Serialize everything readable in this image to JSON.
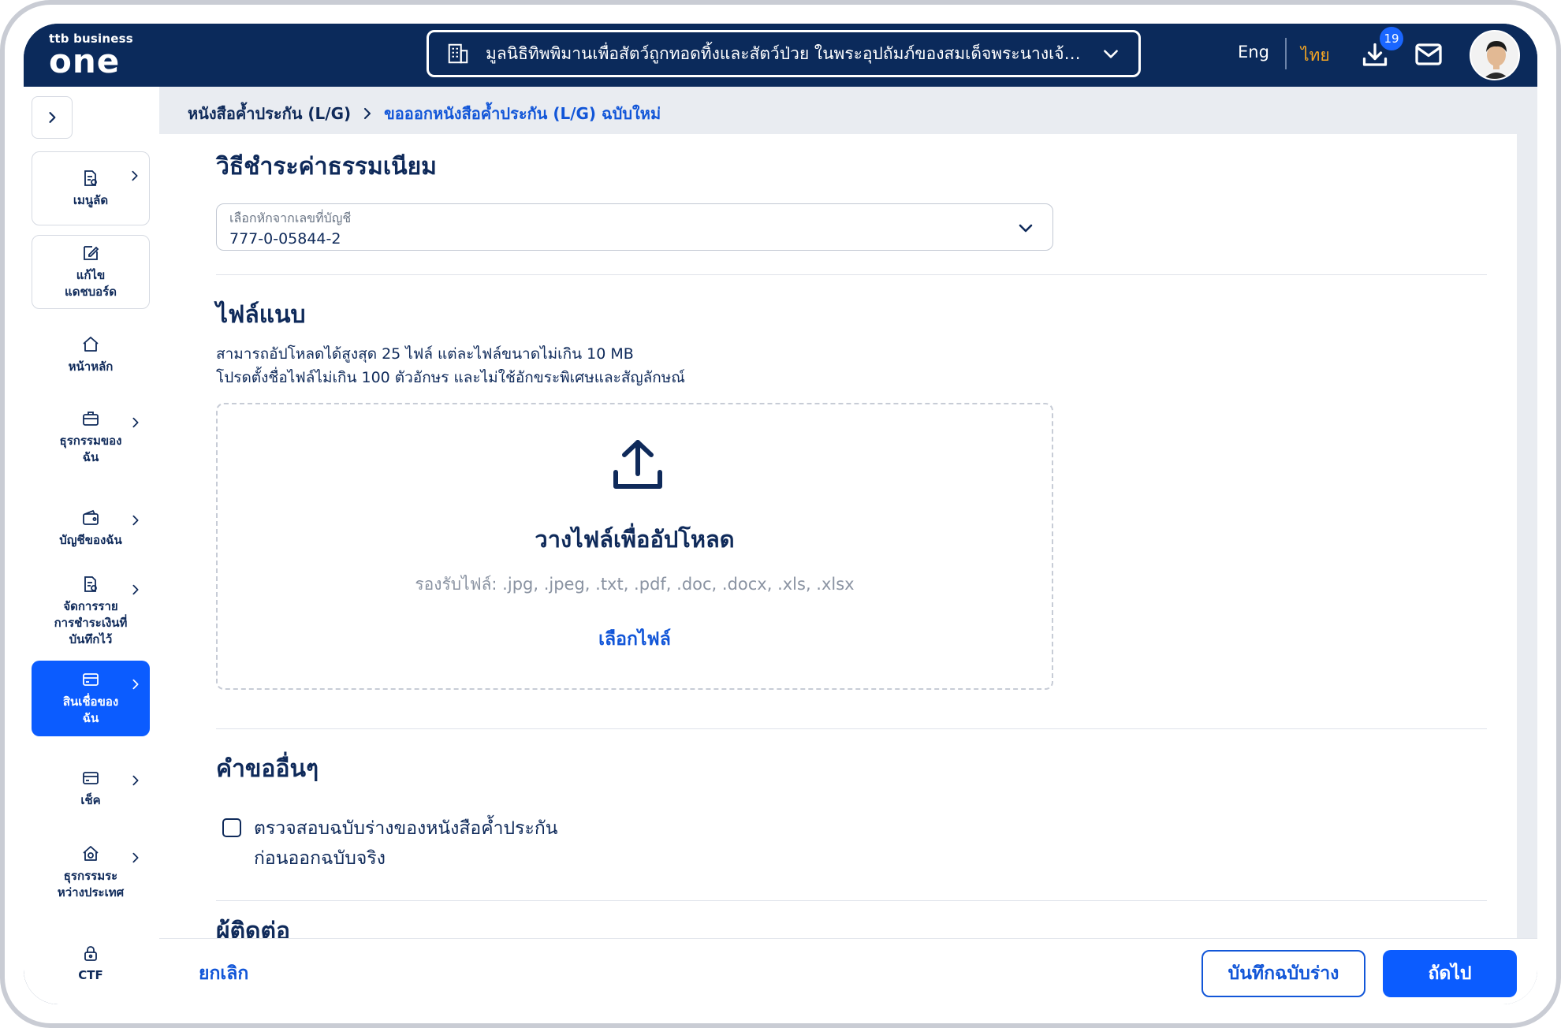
{
  "header": {
    "logo_small": "ttb business",
    "logo_big": "one",
    "org_name": "มูลนิธิทิพพิมานเพื่อสัตว์ถูกทอดทิ้งและสัตว์ป่วย ในพระอุปถัมภ์ของสมเด็จพระนางเจ้า...",
    "lang_eng": "Eng",
    "lang_thai": "ไทย",
    "download_badge": "19",
    "icons": [
      "building-icon",
      "chevron-down-icon",
      "download-icon",
      "mail-icon"
    ]
  },
  "sidebar": {
    "items": [
      {
        "label": "เมนูลัด",
        "icon": "document-icon",
        "has_arrow": true
      },
      {
        "label": "แก้ไข\nแดชบอร์ด",
        "icon": "edit-icon",
        "has_arrow": false
      },
      {
        "label": "หน้าหลัก",
        "icon": "home-icon",
        "has_arrow": false
      },
      {
        "label": "ธุรกรรมของ\nฉัน",
        "icon": "briefcase-icon",
        "has_arrow": true
      },
      {
        "label": "บัญชีของฉัน",
        "icon": "wallet-icon",
        "has_arrow": true
      },
      {
        "label": "จัดการราย\nการชำระเงินที่\nบันทึกไว้",
        "icon": "document-icon",
        "has_arrow": true
      },
      {
        "label": "สินเชื่อของ\nฉัน",
        "icon": "card-icon",
        "has_arrow": true,
        "active": true
      },
      {
        "label": "เช็ค",
        "icon": "cheque-icon",
        "has_arrow": true
      },
      {
        "label": "ธุรกรรมระ\nหว่างประเทศ",
        "icon": "globe-home-icon",
        "has_arrow": true
      },
      {
        "label": "CTF",
        "icon": "lock-icon",
        "has_arrow": false
      }
    ]
  },
  "breadcrumb": {
    "parent": "หนังสือค้ำประกัน (L/G)",
    "current": "ขอออกหนังสือค้ำประกัน (L/G) ฉบับใหม่"
  },
  "payment": {
    "title": "วิธีชำระค่าธรรมเนียม",
    "account_label": "เลือกหักจากเลขที่บัญชี",
    "account_value": "777-0-05844-2"
  },
  "attachments": {
    "title": "ไฟล์แนบ",
    "note1": "สามารถอัปโหลดได้สูงสุด 25 ไฟล์ แต่ละไฟล์ขนาดไม่เกิน 10 MB",
    "note2": "โปรดตั้งชื่อไฟล์ไม่เกิน 100 ตัวอักษร และไม่ใช้อักขระพิเศษและสัญลักษณ์",
    "drop_title": "วางไฟล์เพื่ออัปโหลด",
    "accepted": "รองรับไฟล์: .jpg, .jpeg, .txt, .pdf, .doc, .docx, .xls, .xlsx",
    "choose": "เลือกไฟล์"
  },
  "other": {
    "title": "คำขออื่นๆ",
    "checkbox_line1": "ตรวจสอบฉบับร่างของหนังสือค้ำประกัน",
    "checkbox_line2": "ก่อนออกฉบับจริง",
    "checked": false
  },
  "contact": {
    "title": "ผู้ติดต่อ"
  },
  "footer": {
    "cancel": "ยกเลิก",
    "save_draft": "บันทึกฉบับร่าง",
    "next": "ถัดไป"
  },
  "colors": {
    "navy": "#0b2a5b",
    "primary": "#0b5cff",
    "link": "#1256d8",
    "accent_orange": "#f6a623"
  }
}
